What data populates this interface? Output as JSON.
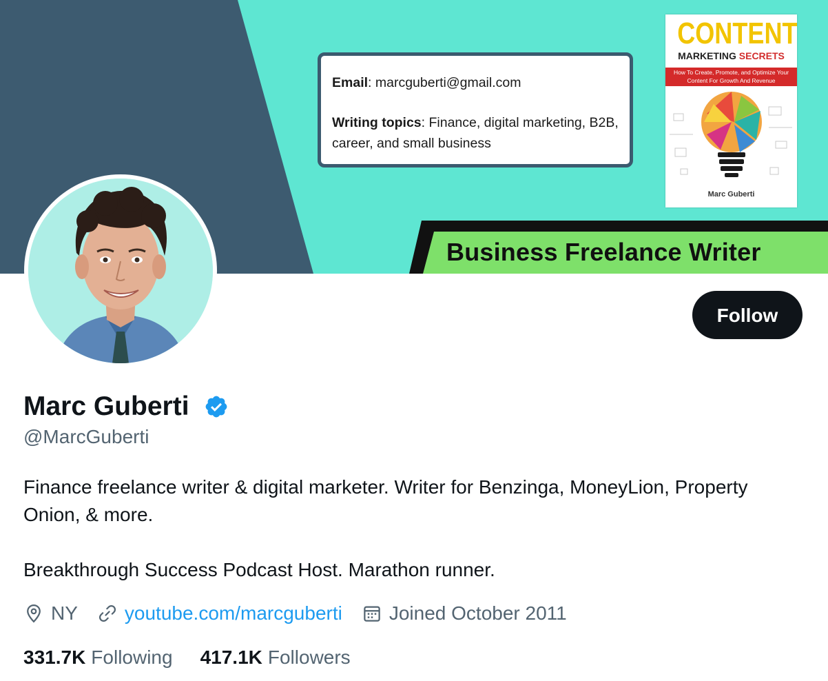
{
  "banner": {
    "info_card": {
      "email_label": "Email",
      "email_value": ": marcguberti@gmail.com",
      "topics_label": "Writing topics",
      "topics_value": ": Finance, digital marketing, B2B, career, and small business"
    },
    "book": {
      "title": "CONTENT",
      "subtitle_part1": "MARKETING",
      "subtitle_part2": "SECRETS",
      "band_text": "How To Create, Promote, and Optimize Your Content For Growth And Revenue",
      "author": "Marc Guberti"
    },
    "tagline": "Business Freelance Writer",
    "colors": {
      "turquoise": "#5ee6d2",
      "slate": "#3d5b70",
      "green": "#7ee06a"
    }
  },
  "profile": {
    "follow_label": "Follow",
    "display_name": "Marc Guberti",
    "verified_icon": "verified-badge-icon",
    "handle": "@MarcGuberti",
    "bio_line1": "Finance freelance writer & digital marketer. Writer for Benzinga, MoneyLion, Property Onion, & more.",
    "bio_line2": "Breakthrough Success Podcast Host. Marathon runner.",
    "location": "NY",
    "website": "youtube.com/marcguberti",
    "joined": "Joined October 2011",
    "following_count": "331.7K",
    "following_label": "Following",
    "followers_count": "417.1K",
    "followers_label": "Followers"
  },
  "colors": {
    "accent": "#1d9bf0",
    "text": "#0f1419",
    "muted": "#536471"
  }
}
